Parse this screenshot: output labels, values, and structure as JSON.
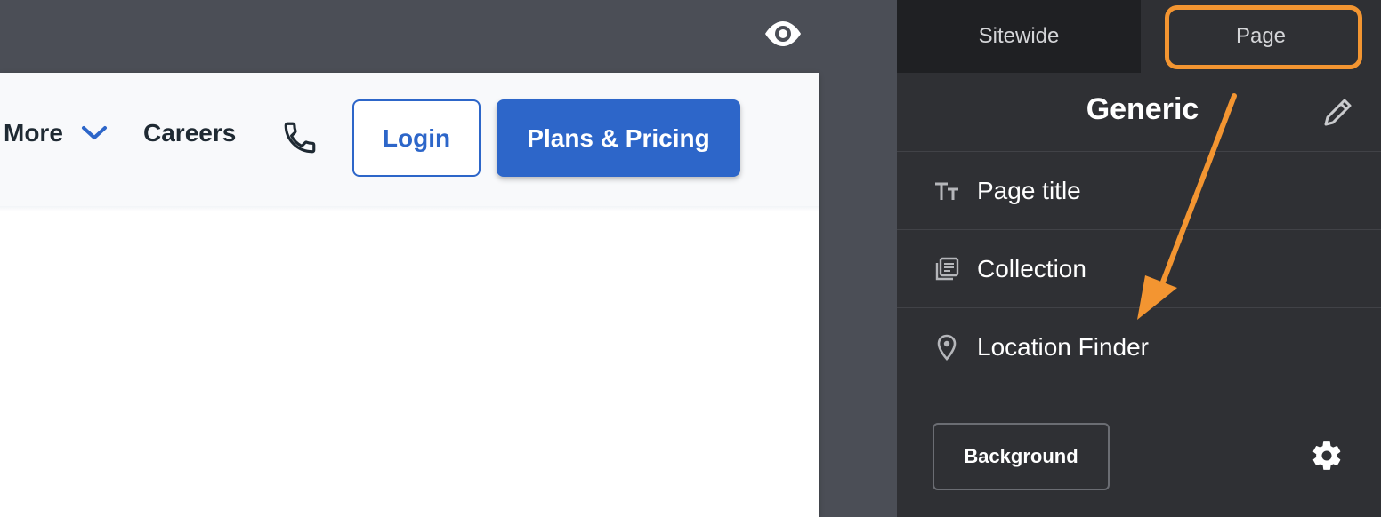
{
  "preview": {
    "visibility_icon": "eye-icon",
    "header": {
      "nav_more": "More",
      "nav_careers": "Careers",
      "phone_icon": "phone-icon",
      "login": "Login",
      "plans": "Plans & Pricing"
    }
  },
  "panel": {
    "tabs": [
      {
        "label": "Sitewide",
        "active": false
      },
      {
        "label": "Page",
        "active": true
      }
    ],
    "title": "Generic",
    "edit_icon": "pencil-icon",
    "items": [
      {
        "label": "Page title",
        "icon": "text-size-icon"
      },
      {
        "label": "Collection",
        "icon": "collection-icon"
      },
      {
        "label": "Location Finder",
        "icon": "map-pin-icon"
      }
    ],
    "background_button": "Background",
    "settings_icon": "gear-icon"
  },
  "annotation": {
    "color": "#f39531"
  },
  "colors": {
    "brand_blue": "#2d66c9",
    "panel_bg": "#2f3034",
    "editor_bg": "#4b4e56"
  }
}
